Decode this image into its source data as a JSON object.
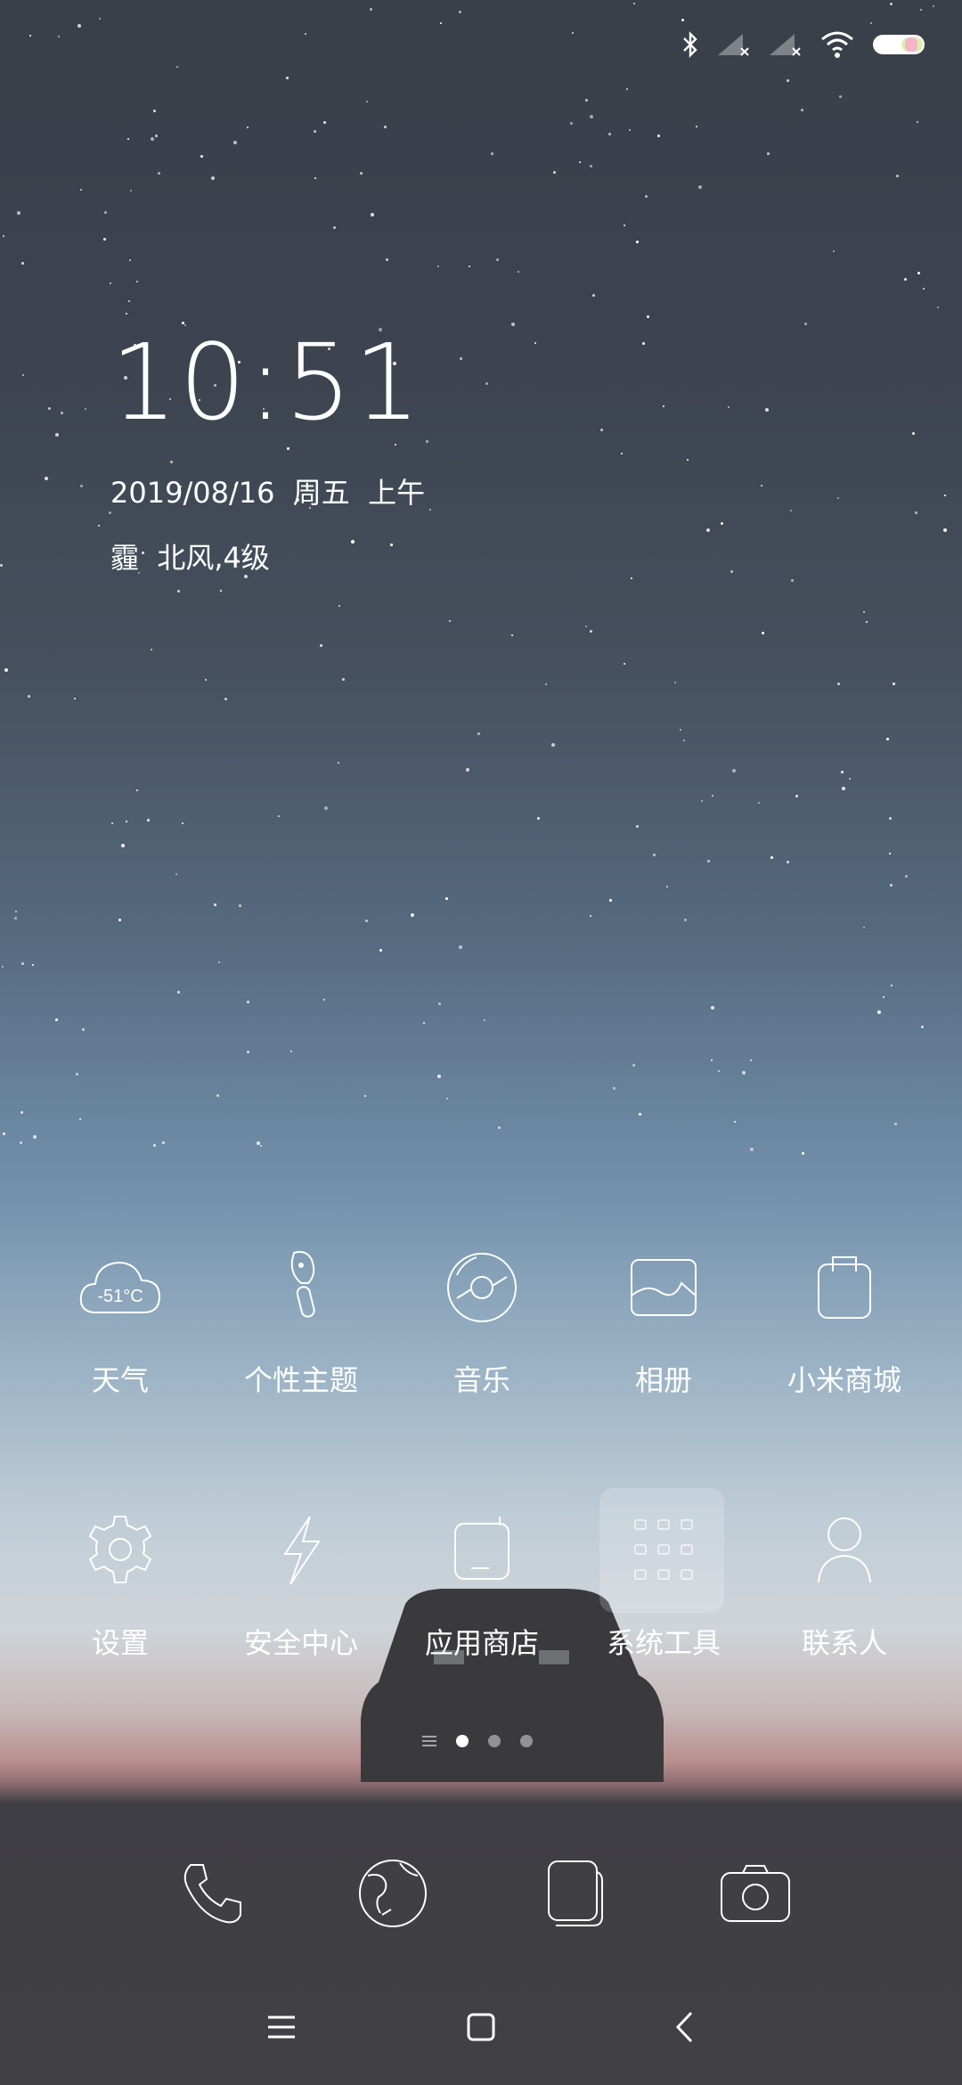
{
  "status_bar": {
    "icons": [
      "bluetooth-icon",
      "signal-sim1-icon",
      "signal-sim2-icon",
      "wifi-icon",
      "battery-icon"
    ]
  },
  "clock_widget": {
    "time": "10:51",
    "date": "2019/08/16  周五  上午",
    "weather": "霾  北风,4级"
  },
  "apps": [
    {
      "label": "天气",
      "icon": "weather-icon",
      "temp": "-51°C"
    },
    {
      "label": "个性主题",
      "icon": "theme-brush-icon"
    },
    {
      "label": "音乐",
      "icon": "music-disc-icon"
    },
    {
      "label": "相册",
      "icon": "gallery-icon"
    },
    {
      "label": "小米商城",
      "icon": "shopping-bag-icon"
    },
    {
      "label": "设置",
      "icon": "gear-icon"
    },
    {
      "label": "安全中心",
      "icon": "lightning-icon"
    },
    {
      "label": "应用商店",
      "icon": "app-store-icon"
    },
    {
      "label": "系统工具",
      "icon": "folder-icon"
    },
    {
      "label": "联系人",
      "icon": "contacts-icon"
    }
  ],
  "page_indicator": {
    "pages": 3,
    "active": 1
  },
  "dock": [
    {
      "icon": "phone-icon"
    },
    {
      "icon": "browser-icon"
    },
    {
      "icon": "messages-icon"
    },
    {
      "icon": "camera-icon"
    }
  ],
  "nav_bar": [
    "menu-icon",
    "home-icon",
    "back-icon"
  ]
}
